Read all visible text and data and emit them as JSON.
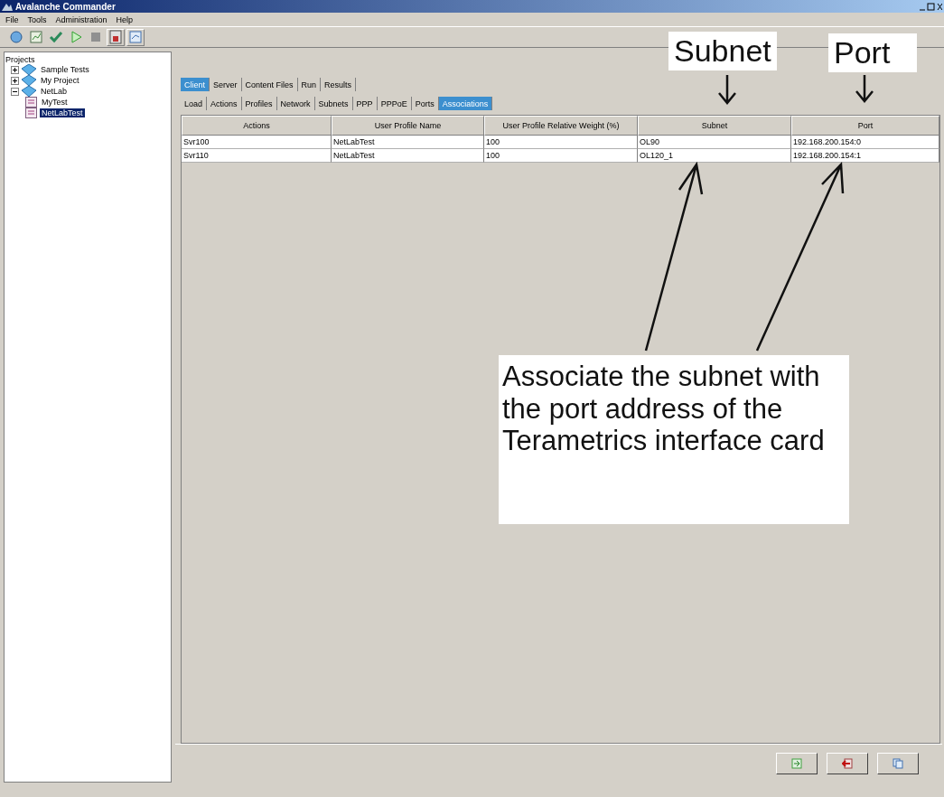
{
  "window": {
    "title": "Avalanche Commander"
  },
  "menu": [
    "File",
    "Tools",
    "Administration",
    "Help"
  ],
  "tree": {
    "label": "Projects",
    "items": [
      {
        "label": "Sample Tests",
        "kind": "project",
        "expanded": false,
        "selected": false
      },
      {
        "label": "My Project",
        "kind": "project",
        "expanded": false,
        "selected": false
      },
      {
        "label": "NetLab",
        "kind": "project",
        "expanded": true,
        "selected": false,
        "children": [
          {
            "label": "MyTest",
            "kind": "test",
            "selected": false
          },
          {
            "label": "NetLabTest",
            "kind": "test",
            "selected": true
          }
        ]
      }
    ]
  },
  "main_tabs": [
    {
      "label": "Client",
      "selected": true
    },
    {
      "label": "Server",
      "selected": false
    },
    {
      "label": "Content Files",
      "selected": false
    },
    {
      "label": "Run",
      "selected": false
    },
    {
      "label": "Results",
      "selected": false
    }
  ],
  "sub_tabs": [
    {
      "label": "Load",
      "selected": false
    },
    {
      "label": "Actions",
      "selected": false
    },
    {
      "label": "Profiles",
      "selected": false
    },
    {
      "label": "Network",
      "selected": false
    },
    {
      "label": "Subnets",
      "selected": false
    },
    {
      "label": "PPP",
      "selected": false
    },
    {
      "label": "PPPoE",
      "selected": false
    },
    {
      "label": "Ports",
      "selected": false
    },
    {
      "label": "Associations",
      "selected": true
    }
  ],
  "table": {
    "columns": [
      "Actions",
      "User Profile Name",
      "User Profile Relative Weight (%)",
      "Subnet",
      "Port"
    ],
    "rows": [
      [
        "Svr100",
        "NetLabTest",
        "100",
        "OL90",
        "192.168.200.154:0"
      ],
      [
        "Svr110",
        "NetLabTest",
        "100",
        "OL120_1",
        "192.168.200.154:1"
      ]
    ]
  },
  "annotations": {
    "subnet_label": "Subnet",
    "port_label": "Port",
    "callout": "Associate the subnet with the port address of the Terametrics interface card"
  }
}
